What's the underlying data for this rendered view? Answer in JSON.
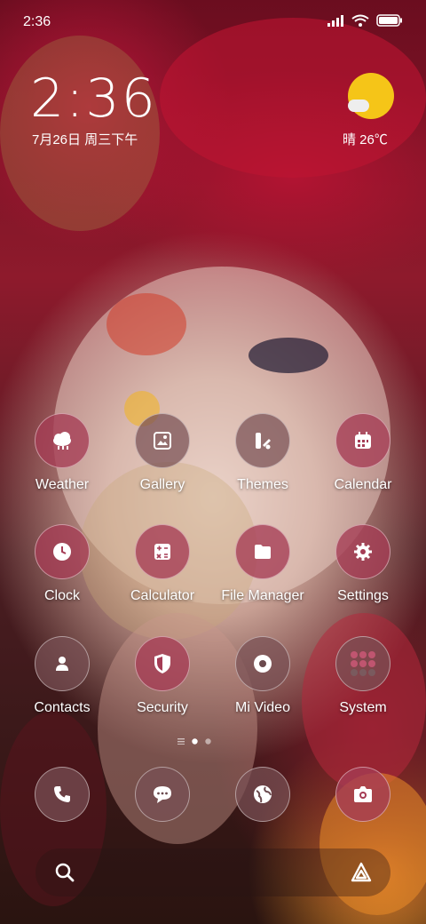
{
  "status_bar": {
    "time": "2:36"
  },
  "lock_clock": {
    "time": "2:36",
    "date": "7月26日 周三下午",
    "weather": "晴 26℃"
  },
  "apps": [
    {
      "label": "Weather"
    },
    {
      "label": "Gallery"
    },
    {
      "label": "Themes"
    },
    {
      "label": "Calendar"
    },
    {
      "label": "Clock"
    },
    {
      "label": "Calculator"
    },
    {
      "label": "File Manager"
    },
    {
      "label": "Settings"
    },
    {
      "label": "Contacts"
    },
    {
      "label": "Security"
    },
    {
      "label": "Mi Video"
    },
    {
      "label": "System"
    }
  ],
  "dock": [
    "phone-icon",
    "messages-icon",
    "browser-icon",
    "camera-icon"
  ],
  "page_indicator": {
    "pages": 2,
    "current": 1
  },
  "colors": {
    "accent_pink": "#a53c55",
    "sun": "#f5c518"
  }
}
